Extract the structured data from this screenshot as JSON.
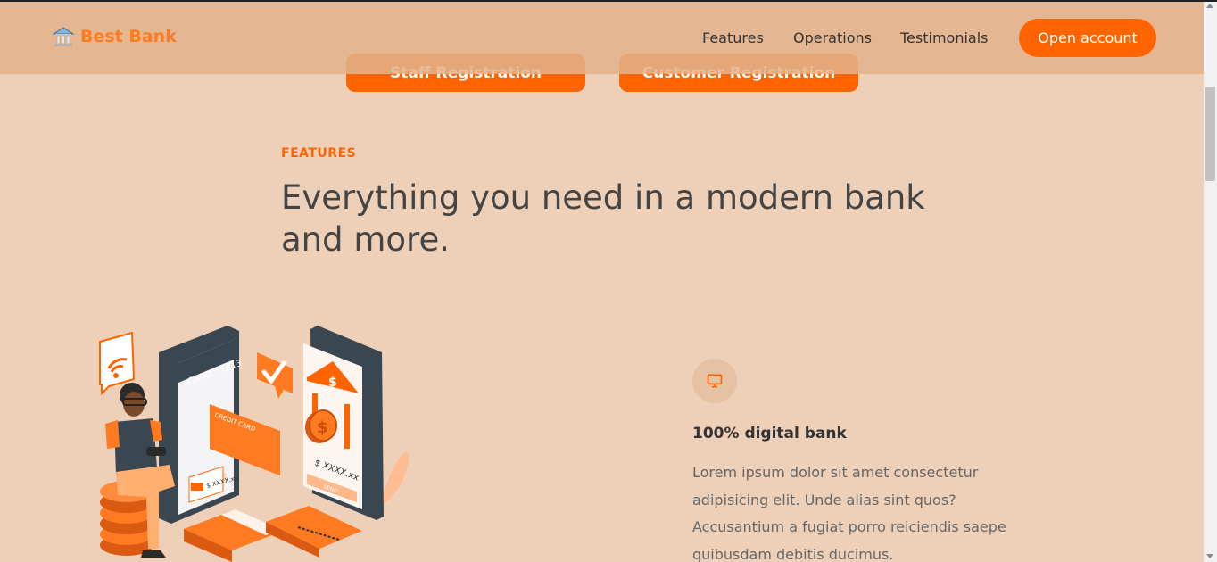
{
  "brand": {
    "name": "Best Bank",
    "logo_icon": "bank-building-icon",
    "color": "#ff7b20"
  },
  "nav": {
    "links": [
      "Features",
      "Operations",
      "Testimonials"
    ],
    "cta": "Open account"
  },
  "registration": {
    "staff_label": "Staff Registration",
    "customer_label": "Customer Registration"
  },
  "features": {
    "tag": "FEATURES",
    "heading": "Everything you need in a modern bank and more.",
    "item": {
      "icon": "monitor-icon",
      "title": "100% digital bank",
      "description": "Lorem ipsum dolor sit amet consectetur adipisicing elit. Unde alias sint quos? Accusantium a fugiat porro reiciendis saepe quibusdam debitis ducimus."
    }
  },
  "illustration": {
    "card_label": "CARD : 1213",
    "credit_card_label": "CREDIT CARD",
    "amount_label": "$ XXXX.xx",
    "send_label": "SEND"
  },
  "colors": {
    "accent": "#ff6400",
    "background": "#eed0b8",
    "navbar": "#e2b28c"
  }
}
